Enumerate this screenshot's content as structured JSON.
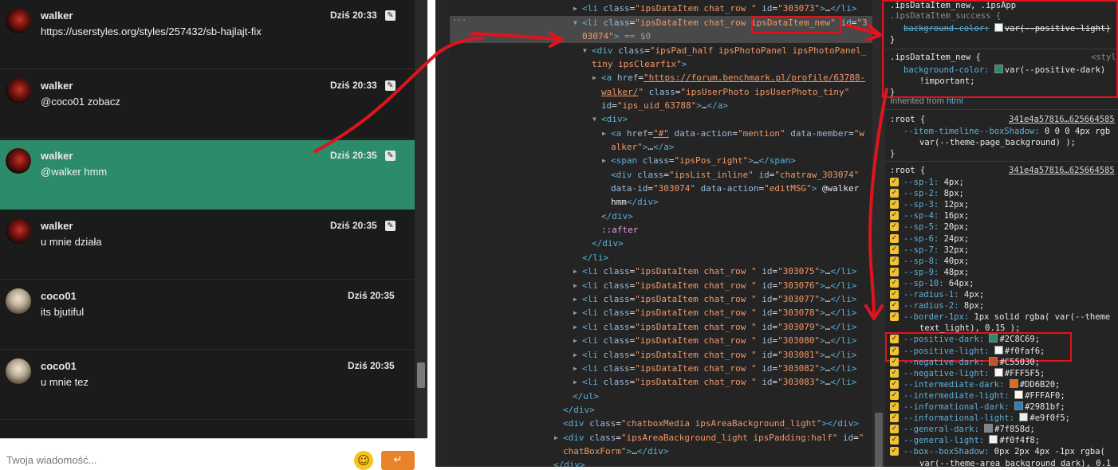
{
  "chat": {
    "messages": [
      {
        "user": "walker",
        "time": "Dziś 20:33",
        "text": "https://userstyles.org/styles/257432/sb-hajlajt-fix",
        "avatar": "walker-avatar",
        "editable": true,
        "active": false
      },
      {
        "user": "walker",
        "time": "Dziś 20:33",
        "text": "@coco01 zobacz",
        "avatar": "walker-avatar",
        "editable": true,
        "active": false
      },
      {
        "user": "walker",
        "time": "Dziś 20:35",
        "text": "@walker hmm",
        "avatar": "walker-avatar",
        "editable": true,
        "active": true
      },
      {
        "user": "walker",
        "time": "Dziś 20:35",
        "text": "u mnie działa",
        "avatar": "walker-avatar",
        "editable": true,
        "active": false
      },
      {
        "user": "coco01",
        "time": "Dziś 20:35",
        "text": "its bjutiful",
        "avatar": "coco-avatar",
        "editable": false,
        "active": false
      },
      {
        "user": "coco01",
        "time": "Dziś 20:35",
        "text": "u mnie tez",
        "avatar": "coco-avatar",
        "editable": false,
        "active": false
      }
    ],
    "input_placeholder": "Twoja wiadomość...",
    "emoji_icon": "smile-emoji-icon",
    "send_icon": "enter-icon",
    "active_color": "#2c8c69"
  },
  "dom": {
    "dots": "···",
    "lines": [
      {
        "indent": 0,
        "arrow": "▶",
        "html": "<span class='tg'>&lt;li</span> <span class='an'>class</span>=<span class='av'>\"ipsDataItem chat_row \"</span> <span class='an'>id</span>=<span class='av'>\"303073\"</span><span class='tg'>&gt;</span>…<span class='tg'>&lt;/li&gt;</span>"
      },
      {
        "indent": 0,
        "arrow": "▼",
        "sel": true,
        "html": "<span class='tg'>&lt;li</span> <span class='an'>class</span>=<span class='av'>\"ipsDataItem chat_row ipsDataItem_new\"</span> <span class='an'>id</span>=<span class='av'>\"3</span>"
      },
      {
        "indent": 0,
        "arrow": "",
        "sel": true,
        "html": "<span class='av'>03074\"</span><span class='tg'>&gt;</span> <span class='eq'>== $0</span>"
      },
      {
        "indent": 1,
        "arrow": "▼",
        "html": "<span class='tg'>&lt;div</span> <span class='an'>class</span>=<span class='av'>\"ipsPad_half ipsPhotoPanel ipsPhotoPanel_</span>"
      },
      {
        "indent": 1,
        "arrow": "",
        "html": "<span class='av'>tiny ipsClearfix\"</span><span class='tg'>&gt;</span>"
      },
      {
        "indent": 2,
        "arrow": "▶",
        "html": "<span class='tg'>&lt;a</span> <span class='an'>href</span>=<span class='lk'>\"https://forum.benchmark.pl/profile/63788-</span>"
      },
      {
        "indent": 2,
        "arrow": "",
        "html": "<span class='lk'>walker/</span><span class='av'>\"</span> <span class='an'>class</span>=<span class='av'>\"ipsUserPhoto ipsUserPhoto_tiny\"</span>"
      },
      {
        "indent": 2,
        "arrow": "",
        "html": "<span class='an'>id</span>=<span class='av'>\"ips_uid_63788\"</span><span class='tg'>&gt;</span>…<span class='tg'>&lt;/a&gt;</span>"
      },
      {
        "indent": 2,
        "arrow": "▼",
        "html": "<span class='tg'>&lt;div&gt;</span>"
      },
      {
        "indent": 3,
        "arrow": "▶",
        "html": "<span class='tg'>&lt;a</span> <span class='an'>href</span>=<span class='lk'>\"#\"</span> <span class='an'>data-action</span>=<span class='av'>\"mention\"</span> <span class='an'>data-member</span>=<span class='av'>\"w</span>"
      },
      {
        "indent": 3,
        "arrow": "",
        "html": "<span class='av'>alker\"</span><span class='tg'>&gt;</span>…<span class='tg'>&lt;/a&gt;</span>"
      },
      {
        "indent": 3,
        "arrow": "▶",
        "html": "<span class='tg'>&lt;span</span> <span class='an'>class</span>=<span class='av'>\"ipsPos_right\"</span><span class='tg'>&gt;</span>…<span class='tg'>&lt;/span&gt;</span>"
      },
      {
        "indent": 3,
        "arrow": "",
        "html": "<span class='tg'>&lt;div</span> <span class='an'>class</span>=<span class='av'>\"ipsList_inline\"</span> <span class='an'>id</span>=<span class='av'>\"chatraw_303074\"</span>"
      },
      {
        "indent": 3,
        "arrow": "",
        "html": "<span class='an'>data-id</span>=<span class='av'>\"303074\"</span> <span class='an'>data-action</span>=<span class='av'>\"editMSG\"</span><span class='tg'>&gt;</span> @walker"
      },
      {
        "indent": 3,
        "arrow": "",
        "html": "hmm<span class='tg'>&lt;/div&gt;</span>"
      },
      {
        "indent": 2,
        "arrow": "",
        "html": "<span class='tg'>&lt;/div&gt;</span>"
      },
      {
        "indent": 2,
        "arrow": "",
        "html": "<span class='ps'>::after</span>"
      },
      {
        "indent": 1,
        "arrow": "",
        "html": "<span class='tg'>&lt;/div&gt;</span>"
      },
      {
        "indent": 0,
        "arrow": "",
        "html": "<span class='tg'>&lt;/li&gt;</span>"
      },
      {
        "indent": 0,
        "arrow": "▶",
        "html": "<span class='tg'>&lt;li</span> <span class='an'>class</span>=<span class='av'>\"ipsDataItem chat_row \"</span> <span class='an'>id</span>=<span class='av'>\"303075\"</span><span class='tg'>&gt;</span>…<span class='tg'>&lt;/li&gt;</span>"
      },
      {
        "indent": 0,
        "arrow": "▶",
        "html": "<span class='tg'>&lt;li</span> <span class='an'>class</span>=<span class='av'>\"ipsDataItem chat_row \"</span> <span class='an'>id</span>=<span class='av'>\"303076\"</span><span class='tg'>&gt;</span>…<span class='tg'>&lt;/li&gt;</span>"
      },
      {
        "indent": 0,
        "arrow": "▶",
        "html": "<span class='tg'>&lt;li</span> <span class='an'>class</span>=<span class='av'>\"ipsDataItem chat_row \"</span> <span class='an'>id</span>=<span class='av'>\"303077\"</span><span class='tg'>&gt;</span>…<span class='tg'>&lt;/li&gt;</span>"
      },
      {
        "indent": 0,
        "arrow": "▶",
        "html": "<span class='tg'>&lt;li</span> <span class='an'>class</span>=<span class='av'>\"ipsDataItem chat_row \"</span> <span class='an'>id</span>=<span class='av'>\"303078\"</span><span class='tg'>&gt;</span>…<span class='tg'>&lt;/li&gt;</span>"
      },
      {
        "indent": 0,
        "arrow": "▶",
        "html": "<span class='tg'>&lt;li</span> <span class='an'>class</span>=<span class='av'>\"ipsDataItem chat_row \"</span> <span class='an'>id</span>=<span class='av'>\"303079\"</span><span class='tg'>&gt;</span>…<span class='tg'>&lt;/li&gt;</span>"
      },
      {
        "indent": 0,
        "arrow": "▶",
        "html": "<span class='tg'>&lt;li</span> <span class='an'>class</span>=<span class='av'>\"ipsDataItem chat_row \"</span> <span class='an'>id</span>=<span class='av'>\"303080\"</span><span class='tg'>&gt;</span>…<span class='tg'>&lt;/li&gt;</span>"
      },
      {
        "indent": 0,
        "arrow": "▶",
        "html": "<span class='tg'>&lt;li</span> <span class='an'>class</span>=<span class='av'>\"ipsDataItem chat_row \"</span> <span class='an'>id</span>=<span class='av'>\"303081\"</span><span class='tg'>&gt;</span>…<span class='tg'>&lt;/li&gt;</span>"
      },
      {
        "indent": 0,
        "arrow": "▶",
        "html": "<span class='tg'>&lt;li</span> <span class='an'>class</span>=<span class='av'>\"ipsDataItem chat_row \"</span> <span class='an'>id</span>=<span class='av'>\"303082\"</span><span class='tg'>&gt;</span>…<span class='tg'>&lt;/li&gt;</span>"
      },
      {
        "indent": 0,
        "arrow": "▶",
        "html": "<span class='tg'>&lt;li</span> <span class='an'>class</span>=<span class='av'>\"ipsDataItem chat_row \"</span> <span class='an'>id</span>=<span class='av'>\"303083\"</span><span class='tg'>&gt;</span>…<span class='tg'>&lt;/li&gt;</span>"
      },
      {
        "indent": -1,
        "arrow": "",
        "html": "<span class='tg'>&lt;/ul&gt;</span>"
      },
      {
        "indent": -2,
        "arrow": "",
        "html": "<span class='tg'>&lt;/div&gt;</span>"
      },
      {
        "indent": -2,
        "arrow": "",
        "html": "<span class='tg'>&lt;div</span> <span class='an'>class</span>=<span class='av'>\"chatboxMedia ipsAreaBackground_light\"</span><span class='tg'>&gt;&lt;/div&gt;</span>"
      },
      {
        "indent": -2,
        "arrow": "▶",
        "html": "<span class='tg'>&lt;div</span> <span class='an'>class</span>=<span class='av'>\"ipsAreaBackground_light ipsPadding:half\"</span> <span class='an'>id</span>=<span class='av'>\"</span>"
      },
      {
        "indent": -2,
        "arrow": "",
        "html": "<span class='av'>chatBoxForm\"</span><span class='tg'>&gt;</span>…<span class='tg'>&lt;/div&gt;</span>"
      },
      {
        "indent": -3,
        "arrow": "",
        "html": "<span class='tg'>&lt;/div&gt;</span>"
      }
    ]
  },
  "styles": {
    "rule1": {
      "selector1": ".ipsDataItem_new, .ipsApp",
      "selector2": ".ipsDataItem_success {",
      "prop": "background-color:",
      "value": "var(--positive-light)",
      "close": "}"
    },
    "rule2": {
      "selector": ".ipsDataItem_new {",
      "source": "<styl",
      "prop": "background-color:",
      "value": "var(--positive-dark)",
      "important": "!important;",
      "close": "}"
    },
    "inherited_label": "Inherited from",
    "inherited_from": "html",
    "root1": {
      "selector": ":root {",
      "source": "341e4a57816…625664585",
      "prop": "--item-timeline--boxShadow:",
      "value": "0 0 0 4px rgb",
      "value2": "var(--theme-page_background) );",
      "close": "}"
    },
    "root2": {
      "selector": ":root {",
      "source": "341e4a57816…625664585"
    },
    "vars": [
      {
        "prop": "--sp-1:",
        "value": "4px;"
      },
      {
        "prop": "--sp-2:",
        "value": "8px;"
      },
      {
        "prop": "--sp-3:",
        "value": "12px;"
      },
      {
        "prop": "--sp-4:",
        "value": "16px;"
      },
      {
        "prop": "--sp-5:",
        "value": "20px;"
      },
      {
        "prop": "--sp-6:",
        "value": "24px;"
      },
      {
        "prop": "--sp-7:",
        "value": "32px;"
      },
      {
        "prop": "--sp-8:",
        "value": "40px;"
      },
      {
        "prop": "--sp-9:",
        "value": "48px;"
      },
      {
        "prop": "--sp-10:",
        "value": "64px;"
      },
      {
        "prop": "--radius-1:",
        "value": "4px;"
      },
      {
        "prop": "--radius-2:",
        "value": "8px;"
      },
      {
        "prop": "--border-1px:",
        "value": "1px solid rgba( var(--theme"
      },
      {
        "prop": "",
        "value": "text_light), 0.15 );",
        "cont": true
      },
      {
        "prop": "--positive-dark:",
        "value": "#2C8C69;",
        "swatch": "#2c8c69"
      },
      {
        "prop": "--positive-light:",
        "value": "#f0faf6;",
        "swatch": "#f0faf6"
      },
      {
        "prop": "--negative-dark:",
        "value": "#C55030;",
        "swatch": "#c55030"
      },
      {
        "prop": "--negative-light:",
        "value": "#FFF5F5;",
        "swatch": "#fff5f5"
      },
      {
        "prop": "--intermediate-dark:",
        "value": "#DD6B20;",
        "swatch": "#dd6b20"
      },
      {
        "prop": "--intermediate-light:",
        "value": "#FFFAF0;",
        "swatch": "#fffaf0"
      },
      {
        "prop": "--informational-dark:",
        "value": "#2981bf;",
        "swatch": "#2981bf"
      },
      {
        "prop": "--informational-light:",
        "value": "#e9f0f5;",
        "swatch": "#e9f0f5"
      },
      {
        "prop": "--general-dark:",
        "value": "#7f858d;",
        "swatch": "#7f858d"
      },
      {
        "prop": "--general-light:",
        "value": "#f0f4f8;",
        "swatch": "#f0f4f8"
      },
      {
        "prop": "--box--boxShadow:",
        "value": "0px 2px 4px -1px rgba("
      },
      {
        "prop": "",
        "value": "var(--theme-area_background_dark), 0.1",
        "cont": true
      }
    ]
  }
}
